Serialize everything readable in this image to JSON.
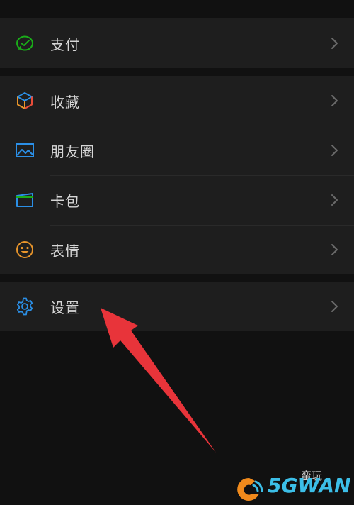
{
  "colors": {
    "background": "#111111",
    "row": "#1e1e1e",
    "text": "#d6d6d6",
    "chevron": "#6a6a6a",
    "pay_icon": "#1aad19",
    "blue_icon": "#2b8fe6",
    "emoji_icon": "#e8952b",
    "arrow": "#e8343a"
  },
  "menu": {
    "pay": {
      "label": "支付",
      "icon": "wechat-pay-icon"
    },
    "favorites": {
      "label": "收藏",
      "icon": "cube-icon"
    },
    "moments": {
      "label": "朋友圈",
      "icon": "image-icon"
    },
    "cards": {
      "label": "卡包",
      "icon": "card-wallet-icon"
    },
    "stickers": {
      "label": "表情",
      "icon": "smiley-icon"
    },
    "settings": {
      "label": "设置",
      "icon": "gear-icon"
    }
  },
  "watermark": {
    "brand": "5GWAN",
    "subtitle": "蛮玩"
  }
}
